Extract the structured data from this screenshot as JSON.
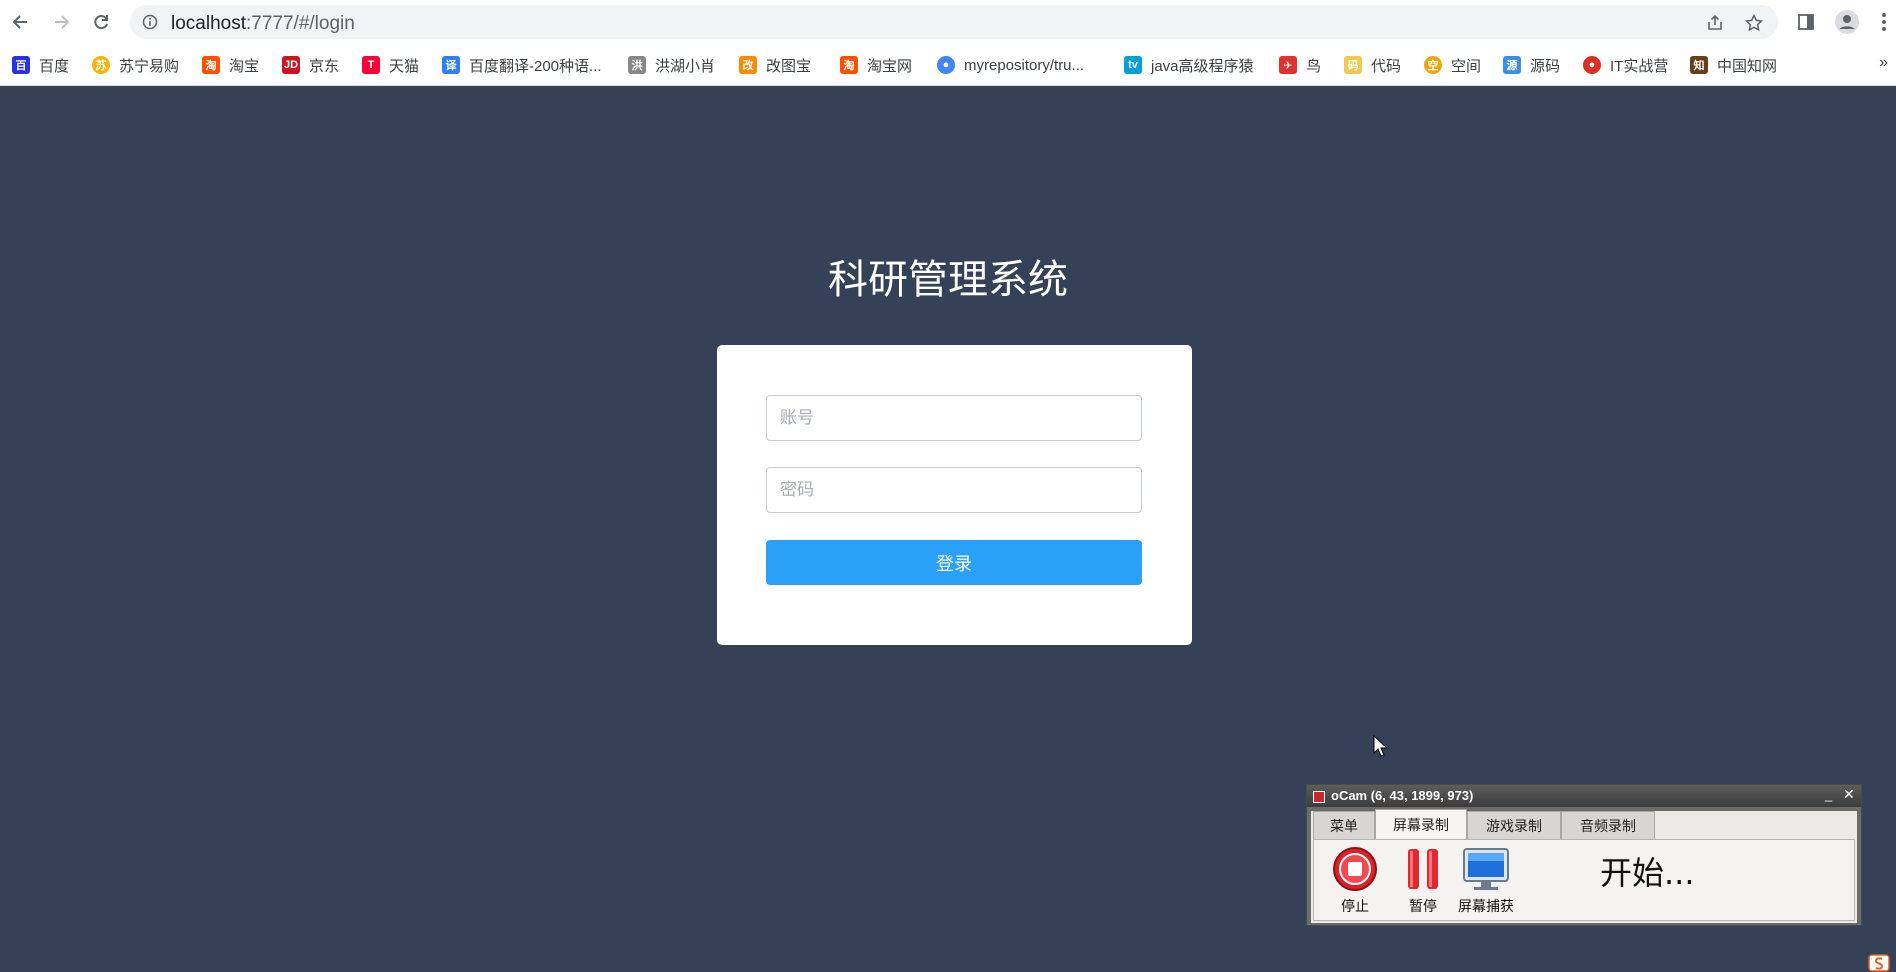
{
  "browser": {
    "url_host": "localhost",
    "url_rest": ":7777/#/login",
    "bookmarks": [
      {
        "label": "百度",
        "icon": "baidu-paw-icon",
        "color": "#2932e1"
      },
      {
        "label": "苏宁易购",
        "icon": "suning-icon",
        "color": "#f9b400"
      },
      {
        "label": "淘宝",
        "icon": "taobao-icon",
        "color": "#ff5000"
      },
      {
        "label": "京东",
        "icon": "jd-icon",
        "color": "#c91623"
      },
      {
        "label": "天猫",
        "icon": "tmall-icon",
        "color": "#ff0036"
      },
      {
        "label": "百度翻译-200种语...",
        "icon": "baidu-translate-icon",
        "color": "#2f7ef5"
      },
      {
        "label": "洪湖小肖",
        "icon": "hongbu-icon",
        "color": "#888888"
      },
      {
        "label": "改图宝",
        "icon": "gaitubao-icon",
        "color": "#ff8a00"
      },
      {
        "label": "淘宝网",
        "icon": "taobao-net-icon",
        "color": "#ff5000"
      },
      {
        "label": "myrepository/tru...",
        "icon": "chrome-icon",
        "color": "#4285f4"
      },
      {
        "label": "java高级程序猿",
        "icon": "bilibili-icon",
        "color": "#00a1d6"
      },
      {
        "label": "鸟",
        "icon": "bird-icon",
        "color": "#e0322c"
      },
      {
        "label": "代码",
        "icon": "code-icon",
        "color": "#f2c94c"
      },
      {
        "label": "空间",
        "icon": "qzone-icon",
        "color": "#f0a400"
      },
      {
        "label": "源码",
        "icon": "source-icon",
        "color": "#3a8ee6"
      },
      {
        "label": "IT实战营",
        "icon": "chrome-red-icon",
        "color": "#d93025"
      },
      {
        "label": "中国知网",
        "icon": "cnki-icon",
        "color": "#6b3e1a"
      }
    ]
  },
  "page": {
    "title": "科研管理系统",
    "account_placeholder": "账号",
    "password_placeholder": "密码",
    "login_label": "登录"
  },
  "ocam": {
    "title": "oCam (6, 43, 1899, 973)",
    "min": "_",
    "close": "✕",
    "tabs": [
      "菜单",
      "屏幕录制",
      "游戏录制",
      "音频录制"
    ],
    "active_tab": "屏幕录制",
    "tools": {
      "stop": "停止",
      "pause": "暂停",
      "capture": "屏幕捕获"
    },
    "status": "开始..."
  },
  "colors": {
    "page_bg": "#344157",
    "primary_button": "#2aa0f9"
  }
}
